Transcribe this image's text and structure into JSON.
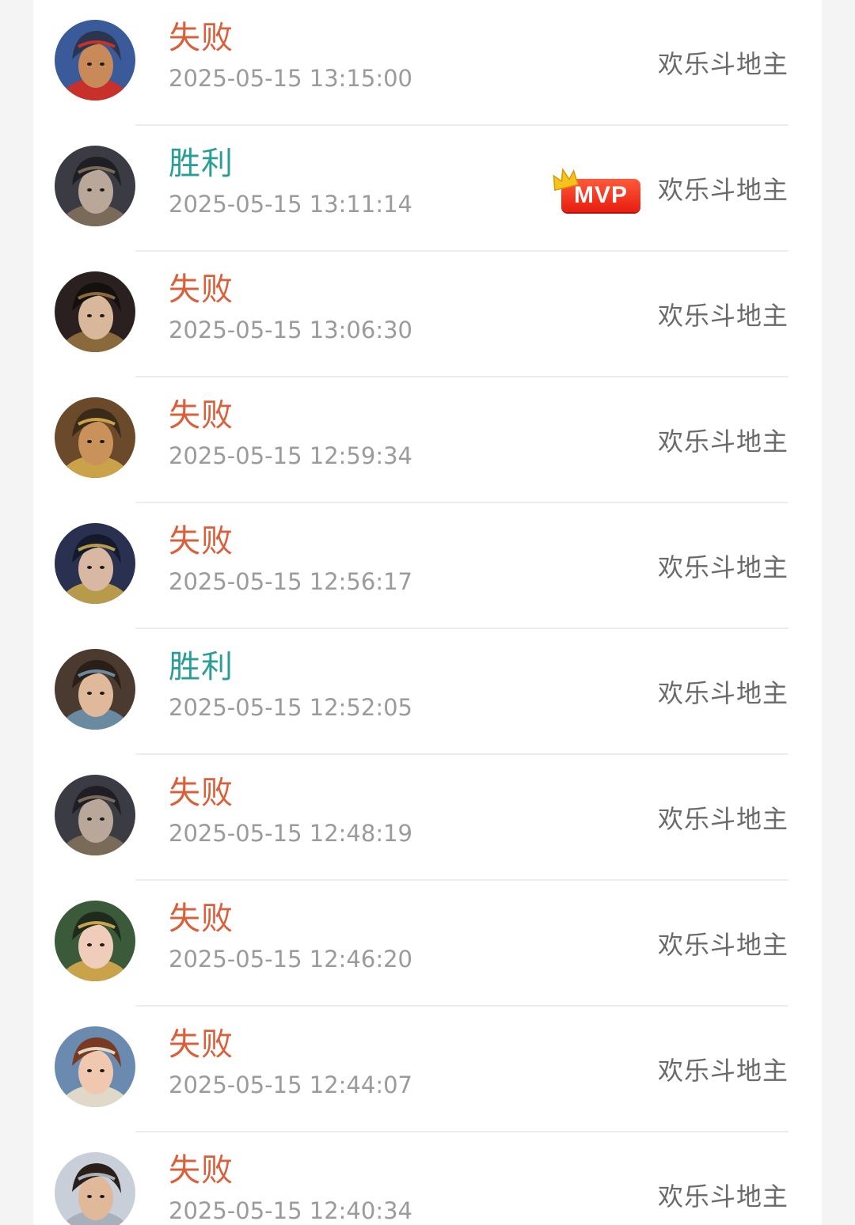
{
  "colors": {
    "loss": "#d9603b",
    "win": "#2a9d98",
    "time": "#9b9b9b",
    "game": "#6a6a6a",
    "mvp_badge": "#e8261a",
    "crown": "#f6c21c"
  },
  "records": [
    {
      "result": "失败",
      "outcome": "loss",
      "time": "2025-05-15 13:15:00",
      "game": "欢乐斗地主",
      "mvp": false,
      "avatar_icon": "warrior-red-headband-avatar",
      "avatar_colors": [
        "#3a5a9a",
        "#c98a5a",
        "#2b3550",
        "#c8302a"
      ]
    },
    {
      "result": "胜利",
      "outcome": "win",
      "time": "2025-05-15 13:11:14",
      "game": "欢乐斗地主",
      "mvp": true,
      "mvp_label": "MVP",
      "avatar_icon": "dark-armored-general-avatar",
      "avatar_colors": [
        "#3b3b44",
        "#b9a89a",
        "#1e1e24",
        "#7a6a58"
      ]
    },
    {
      "result": "失败",
      "outcome": "loss",
      "time": "2025-05-15 13:06:30",
      "game": "欢乐斗地主",
      "mvp": false,
      "avatar_icon": "long-hair-scholar-avatar",
      "avatar_colors": [
        "#2a2020",
        "#d9b79a",
        "#151010",
        "#8a6a3a"
      ]
    },
    {
      "result": "失败",
      "outcome": "loss",
      "time": "2025-05-15 12:59:34",
      "game": "欢乐斗地主",
      "mvp": false,
      "avatar_icon": "bearded-general-avatar",
      "avatar_colors": [
        "#6a4a2a",
        "#c9925a",
        "#3a2a1a",
        "#c9a24a"
      ]
    },
    {
      "result": "失败",
      "outcome": "loss",
      "time": "2025-05-15 12:56:17",
      "game": "欢乐斗地主",
      "mvp": false,
      "avatar_icon": "crowned-strategist-avatar",
      "avatar_colors": [
        "#2a3150",
        "#d8b8a2",
        "#141a2c",
        "#b79a4a"
      ]
    },
    {
      "result": "胜利",
      "outcome": "win",
      "time": "2025-05-15 12:52:05",
      "game": "欢乐斗地主",
      "mvp": false,
      "avatar_icon": "smiling-youth-avatar",
      "avatar_colors": [
        "#4a3a30",
        "#e0b99a",
        "#2a1e18",
        "#6a8aa0"
      ]
    },
    {
      "result": "失败",
      "outcome": "loss",
      "time": "2025-05-15 12:48:19",
      "game": "欢乐斗地主",
      "mvp": false,
      "avatar_icon": "dark-armored-general-avatar",
      "avatar_colors": [
        "#3b3b44",
        "#b9a89a",
        "#1e1e24",
        "#7a6a58"
      ]
    },
    {
      "result": "失败",
      "outcome": "loss",
      "time": "2025-05-15 12:46:20",
      "game": "欢乐斗地主",
      "mvp": false,
      "avatar_icon": "green-robed-lady-avatar",
      "avatar_colors": [
        "#3a5a3a",
        "#f0cdbb",
        "#1e2a1c",
        "#c9a24a"
      ]
    },
    {
      "result": "失败",
      "outcome": "loss",
      "time": "2025-05-15 12:44:07",
      "game": "欢乐斗地主",
      "mvp": false,
      "avatar_icon": "auburn-hair-lady-avatar",
      "avatar_colors": [
        "#6a8ab0",
        "#f0c8b0",
        "#7a3a22",
        "#e0d8c8"
      ]
    },
    {
      "result": "失败",
      "outcome": "loss",
      "time": "2025-05-15 12:40:34",
      "game": "欢乐斗地主",
      "mvp": false,
      "avatar_icon": "mustached-lord-avatar",
      "avatar_colors": [
        "#c8cfd8",
        "#e0b89a",
        "#2a1e18",
        "#a8b0bc"
      ]
    }
  ]
}
